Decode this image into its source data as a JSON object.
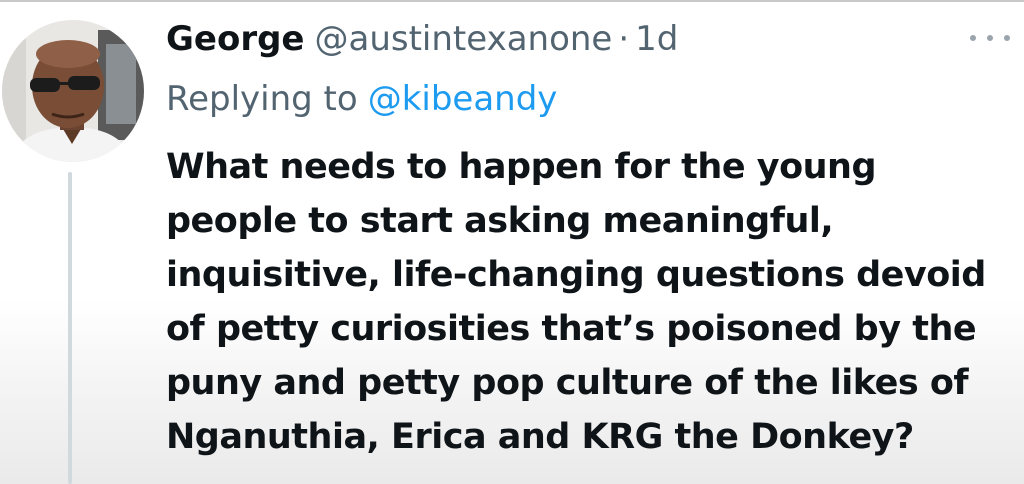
{
  "tweet": {
    "display_name": "George",
    "handle": "@austintexanone",
    "separator": "·",
    "time": "1d",
    "more_icon": "more-horizontal-icon",
    "reply": {
      "prefix": "Replying to",
      "mention": "@kibeandy"
    },
    "body_lines": [
      "What needs to happen for the young",
      "people to start asking meaningful,",
      "inquisitive, life-changing questions devoid",
      "of petty curiosities that’s poisoned by the",
      "puny and petty pop culture of the likes of",
      "Nganuthia, Erica and KRG the Donkey?"
    ]
  },
  "colors": {
    "name": "#0f1419",
    "secondary": "#536471",
    "mention": "#1d9bf0",
    "thread_line": "#cfd9de"
  }
}
